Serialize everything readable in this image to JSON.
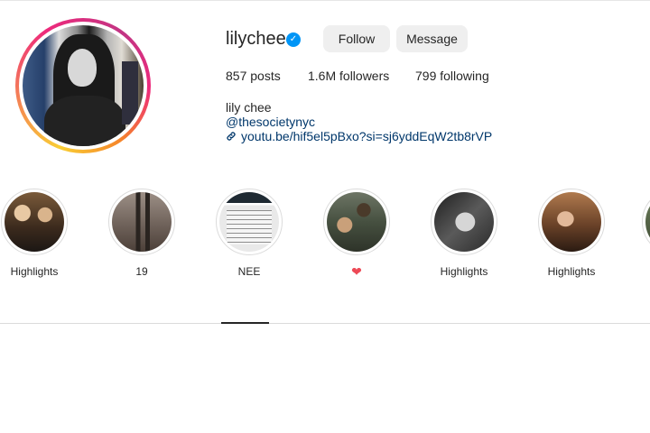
{
  "profile": {
    "username": "lilychee",
    "verified": true,
    "follow_label": "Follow",
    "message_label": "Message",
    "stats": {
      "posts": "857 posts",
      "followers": "1.6M followers",
      "following": "799 following"
    },
    "full_name": "lily chee",
    "tagged_handle": "@thesocietynyc",
    "link": "youtu.be/hif5el5pBxo?si=sj6yddEqW2tb8rVP"
  },
  "highlights": [
    {
      "label": "Highlights"
    },
    {
      "label": "19"
    },
    {
      "label": "NEE"
    },
    {
      "label": "",
      "icon": "heart-icon"
    },
    {
      "label": "Highlights"
    },
    {
      "label": "Highlights"
    }
  ],
  "colors": {
    "link": "#00376b",
    "verified": "#0095f6",
    "button_bg": "#efefef",
    "heart": "#ed4956"
  }
}
